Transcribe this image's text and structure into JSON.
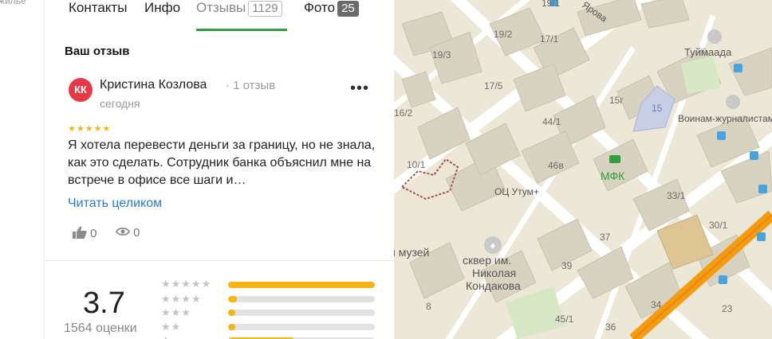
{
  "left_strip": {
    "text": "жилье"
  },
  "tabs": [
    {
      "label": "Контакты"
    },
    {
      "label": "Инфо"
    },
    {
      "label": "Отзывы",
      "count": "1129"
    },
    {
      "label": "Фото",
      "count": "25"
    }
  ],
  "section_title": "Ваш отзыв",
  "review": {
    "avatar_initials": "КК",
    "author": "Кристина Козлова",
    "author_meta": "· 1 отзыв",
    "date": "сегодня",
    "stars": "★★★★★",
    "rating_value": 5,
    "text": "Я хотела перевести деньги за границу, но не знала, как это сделать. Сотрудник банка объяснил мне на встрече в офисе все шаги и…",
    "read_more": "Читать целиком",
    "likes": "0",
    "views": "0",
    "more_icon": "more-dots-icon"
  },
  "summary": {
    "rating": "3.7",
    "count_text": "1564 оценки",
    "rows": [
      {
        "stars": 5,
        "label": "★★★★★",
        "fraction": 1.0
      },
      {
        "stars": 4,
        "label": "★★★★",
        "fraction": 0.06
      },
      {
        "stars": 3,
        "label": "★★★",
        "fraction": 0.05
      },
      {
        "stars": 2,
        "label": "★★",
        "fraction": 0.05
      },
      {
        "stars": 1,
        "label": "★",
        "fraction": 0.45
      }
    ],
    "bar_color": "#f6b417"
  },
  "map": {
    "labels": [
      "19/1",
      "19/2",
      "17/1",
      "19/3",
      "17/5",
      "15г",
      "15",
      "16/2",
      "44/1",
      "46в",
      "10/1",
      "ОЦ Утум+",
      "МФК",
      "33/1",
      "30/1",
      "37",
      "сквер им.",
      "Николая",
      "Кондакова",
      "й музей",
      "39",
      "8",
      "34",
      "45/1",
      "36",
      "23",
      "Туймаада",
      "Воинам-журналистам",
      "Ярова"
    ],
    "road_color": "#f39c12",
    "park_color": "#cfe6c0"
  }
}
